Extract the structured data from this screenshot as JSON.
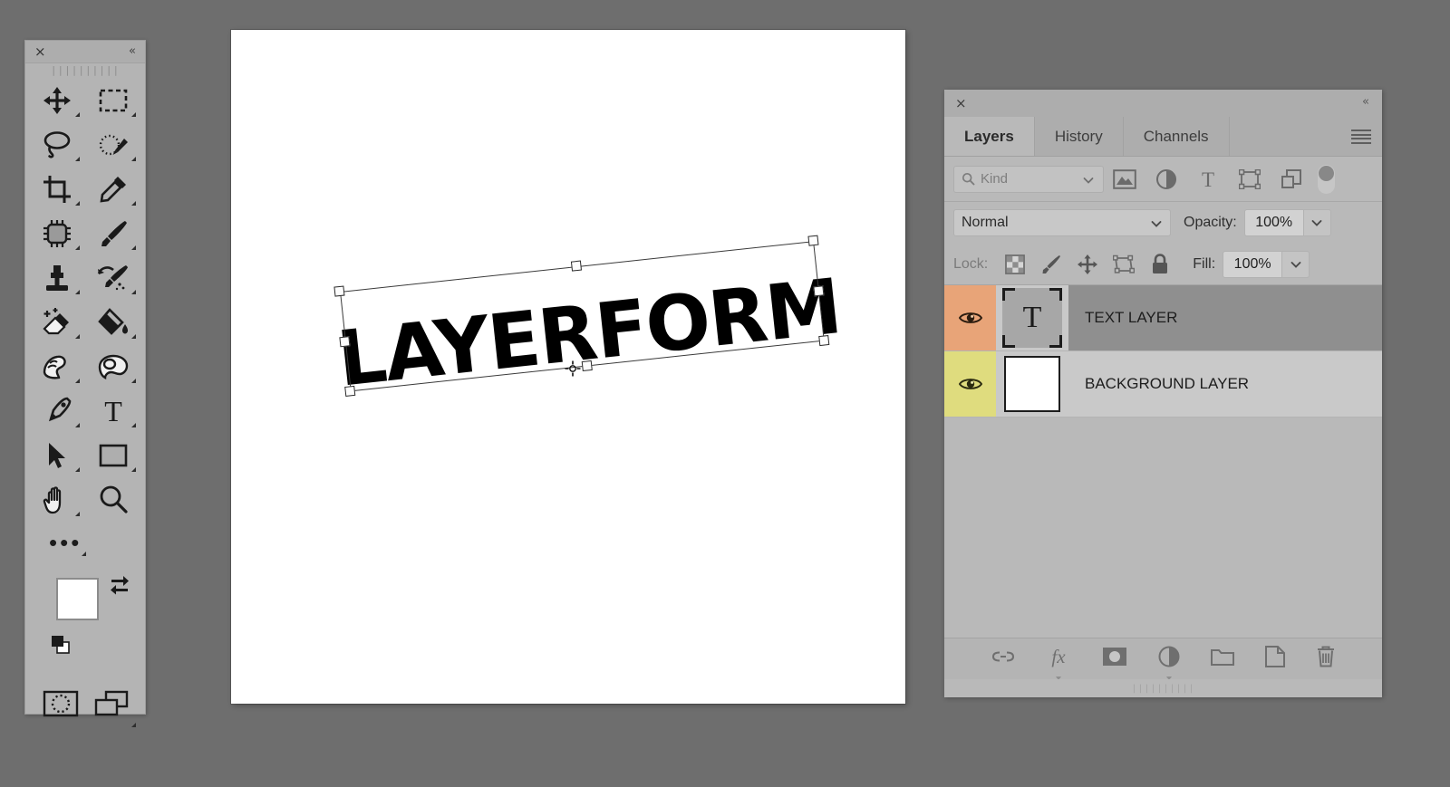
{
  "app": {
    "background_color": "#6e6e6e"
  },
  "canvas": {
    "artwork_text": "LAYERFORM",
    "background_color": "#ffffff",
    "transform_active": true
  },
  "toolbar": {
    "close_label": "×",
    "collapse_label": "«",
    "grip_label": "||||||||||",
    "overflow_label": "•••",
    "tools": [
      {
        "name": "move-tool",
        "icon": "move-icon"
      },
      {
        "name": "rectangular-marquee-tool",
        "icon": "marquee-icon"
      },
      {
        "name": "lasso-tool",
        "icon": "lasso-icon"
      },
      {
        "name": "quick-selection-tool",
        "icon": "quick-selection-icon"
      },
      {
        "name": "crop-tool",
        "icon": "crop-icon"
      },
      {
        "name": "eyedropper-tool",
        "icon": "eyedropper-icon"
      },
      {
        "name": "patch-tool",
        "icon": "patch-icon"
      },
      {
        "name": "brush-tool",
        "icon": "brush-icon"
      },
      {
        "name": "clone-stamp-tool",
        "icon": "clone-stamp-icon"
      },
      {
        "name": "history-brush-tool",
        "icon": "history-brush-icon"
      },
      {
        "name": "eraser-tool",
        "icon": "eraser-icon"
      },
      {
        "name": "paint-bucket-tool",
        "icon": "paint-bucket-icon"
      },
      {
        "name": "blur-tool",
        "icon": "blur-icon"
      },
      {
        "name": "dodge-tool",
        "icon": "dodge-icon"
      },
      {
        "name": "pen-tool",
        "icon": "pen-icon"
      },
      {
        "name": "type-tool",
        "icon": "type-icon"
      },
      {
        "name": "path-selection-tool",
        "icon": "path-selection-icon"
      },
      {
        "name": "rectangle-shape-tool",
        "icon": "rectangle-icon"
      },
      {
        "name": "hand-tool",
        "icon": "hand-icon"
      },
      {
        "name": "zoom-tool",
        "icon": "magnifier-icon"
      }
    ],
    "foreground_color": "#ffffff",
    "background_color": "#000000",
    "swap_icon": "swap-colors-icon",
    "default_colors_icon": "default-colors-icon",
    "quick_mask_icon": "quick-mask-icon",
    "screen_mode_icon": "screen-mode-icon"
  },
  "layers_panel": {
    "close_label": "×",
    "collapse_label": "«",
    "menu_icon": "hamburger-menu-icon",
    "tabs": [
      {
        "label": "Layers",
        "active": true
      },
      {
        "label": "History",
        "active": false
      },
      {
        "label": "Channels",
        "active": false
      }
    ],
    "filter": {
      "search_icon": "search-icon",
      "kind_label": "Kind",
      "chevron_icon": "chevron-down-icon",
      "type_filters": [
        {
          "name": "filter-pixel-layers",
          "icon": "image-icon"
        },
        {
          "name": "filter-adjustment-layers",
          "icon": "adjustment-icon"
        },
        {
          "name": "filter-type-layers",
          "icon": "type-icon"
        },
        {
          "name": "filter-shape-layers",
          "icon": "shape-icon"
        },
        {
          "name": "filter-smart-objects",
          "icon": "smart-object-icon"
        }
      ],
      "toggle_name": "filter-enable-toggle"
    },
    "blend": {
      "mode": "Normal",
      "opacity_label": "Opacity:",
      "opacity_value": "100%",
      "fill_label": "Fill:",
      "fill_value": "100%"
    },
    "lock": {
      "label": "Lock:",
      "items": [
        {
          "name": "lock-transparent-pixels",
          "icon": "checkerboard-icon"
        },
        {
          "name": "lock-image-pixels",
          "icon": "brush-icon"
        },
        {
          "name": "lock-position",
          "icon": "move-icon"
        },
        {
          "name": "lock-artboard-nesting",
          "icon": "artboard-icon"
        },
        {
          "name": "lock-all",
          "icon": "lock-icon"
        }
      ]
    },
    "layers": [
      {
        "name": "TEXT LAYER",
        "visible": true,
        "selected": true,
        "thumb_type": "text",
        "thumb_glyph": "T",
        "eye_color": "#e8a478"
      },
      {
        "name": "BACKGROUND LAYER",
        "visible": true,
        "selected": false,
        "thumb_type": "solid",
        "thumb_color": "#ffffff",
        "eye_color": "#dfdc7e"
      }
    ],
    "bottom_bar": [
      {
        "name": "link-layers-button",
        "icon": "link-icon"
      },
      {
        "name": "layer-style-button",
        "icon": "fx-icon"
      },
      {
        "name": "add-layer-mask-button",
        "icon": "mask-icon"
      },
      {
        "name": "new-adjustment-layer-button",
        "icon": "adjustment-icon"
      },
      {
        "name": "new-group-button",
        "icon": "folder-icon"
      },
      {
        "name": "new-layer-button",
        "icon": "new-layer-icon"
      },
      {
        "name": "delete-layer-button",
        "icon": "trash-icon"
      }
    ],
    "grip_label": "||||||||||"
  }
}
